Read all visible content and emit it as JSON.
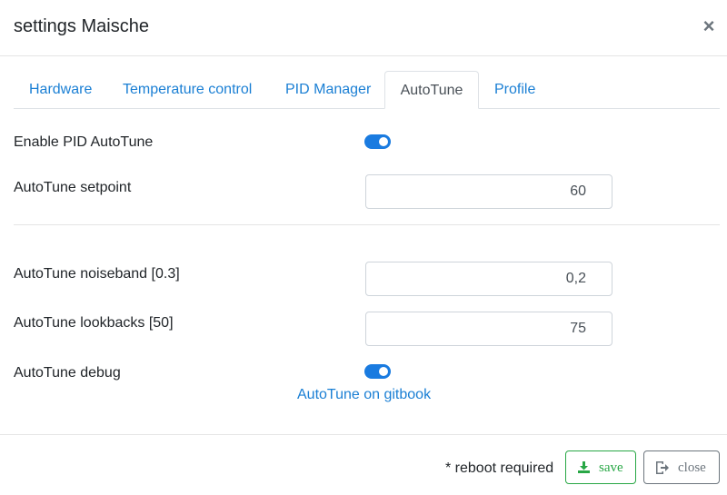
{
  "dialog": {
    "title": "settings Maische",
    "close_glyph": "×"
  },
  "tabs": [
    {
      "label": "Hardware",
      "active": false
    },
    {
      "label": "Temperature control",
      "active": false
    },
    {
      "label": "PID Manager",
      "active": false
    },
    {
      "label": "AutoTune",
      "active": true
    },
    {
      "label": "Profile",
      "active": false
    }
  ],
  "form": {
    "enable_autotune": {
      "label": "Enable PID AutoTune",
      "checked": true
    },
    "setpoint": {
      "label": "AutoTune setpoint",
      "value": "60"
    },
    "noiseband": {
      "label": "AutoTune noiseband [0.3]",
      "value": "0,2"
    },
    "lookbacks": {
      "label": "AutoTune lookbacks [50]",
      "value": "75"
    },
    "debug": {
      "label": "AutoTune debug",
      "checked": true
    },
    "gitbook_link": "AutoTune on gitbook"
  },
  "footer": {
    "reboot_note": "* reboot required",
    "save_label": "save",
    "close_label": "close"
  },
  "colors": {
    "accent": "#1a7be0",
    "link": "#1a7fd4",
    "save": "#28a745",
    "close": "#6c757d"
  },
  "icons": {
    "save": "download-icon",
    "close": "sign-out-icon",
    "dismiss": "close-icon"
  }
}
